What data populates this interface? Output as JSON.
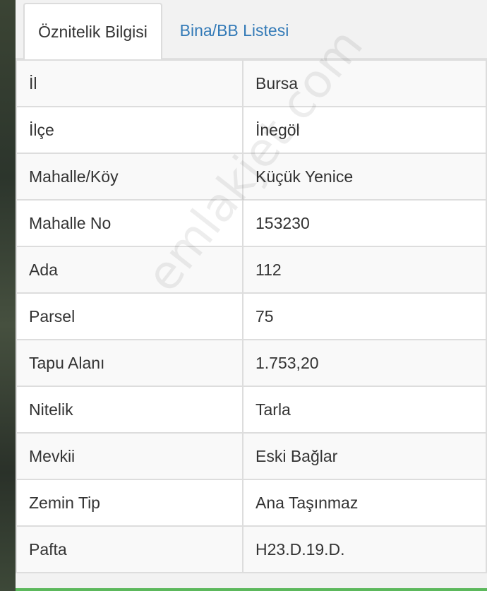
{
  "tabs": [
    {
      "label": "Öznitelik Bilgisi",
      "active": true
    },
    {
      "label": "Bina/BB Listesi",
      "active": false
    }
  ],
  "rows": [
    {
      "key": "İl",
      "value": "Bursa"
    },
    {
      "key": "İlçe",
      "value": "İnegöl"
    },
    {
      "key": "Mahalle/Köy",
      "value": "Küçük Yenice"
    },
    {
      "key": "Mahalle No",
      "value": "153230"
    },
    {
      "key": "Ada",
      "value": "112"
    },
    {
      "key": "Parsel",
      "value": "75"
    },
    {
      "key": "Tapu Alanı",
      "value": "1.753,20"
    },
    {
      "key": "Nitelik",
      "value": "Tarla"
    },
    {
      "key": "Mevkii",
      "value": "Eski Bağlar"
    },
    {
      "key": "Zemin Tip",
      "value": "Ana Taşınmaz"
    },
    {
      "key": "Pafta",
      "value": "H23.D.19.D."
    }
  ],
  "watermark": "emlakjet.com",
  "colors": {
    "tab_link": "#337ab7",
    "accent_bar": "#5cb85c"
  }
}
